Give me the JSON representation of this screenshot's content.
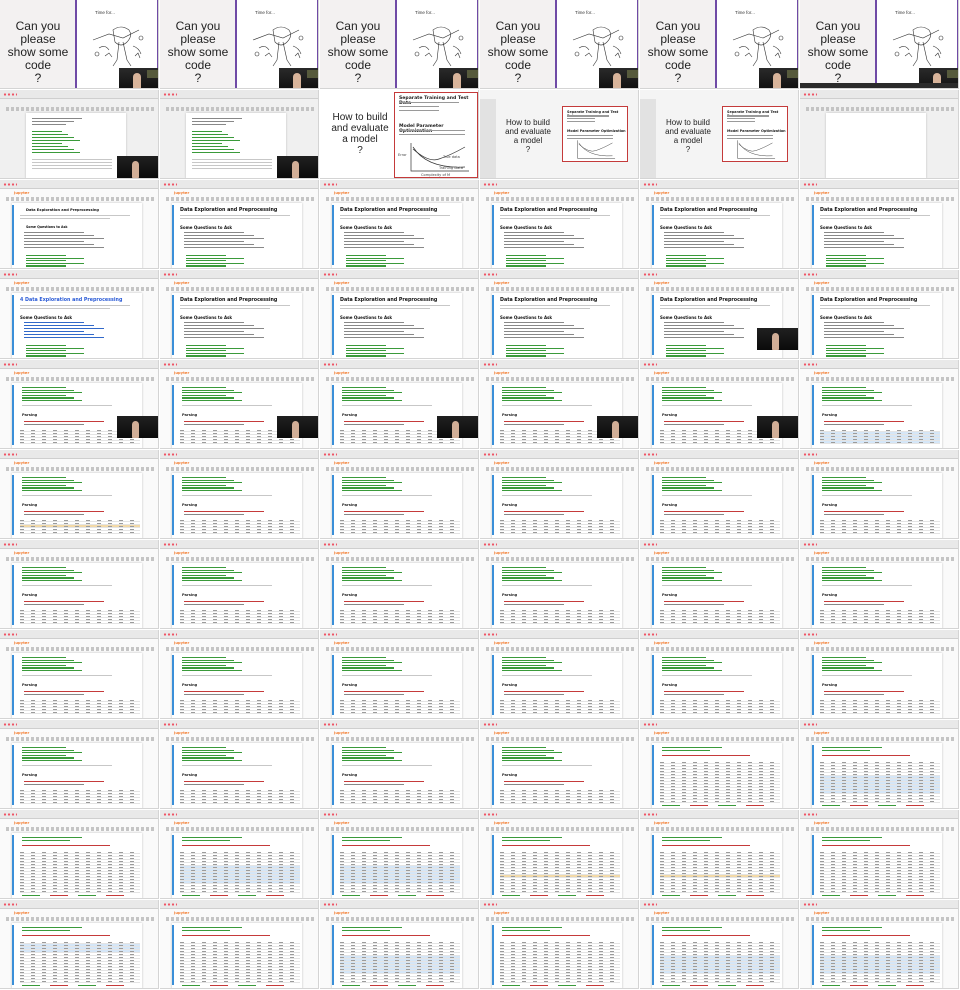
{
  "slides": {
    "code_question": "Can you please\nshow some\ncode\n?",
    "time_for": "Time for...",
    "eval_question": "How to build\nand evaluate\na model\n?",
    "eval_heading_1": "Separate Training and Test Data",
    "eval_heading_2": "Model Parameter Optimization",
    "eval_axis_error": "Error",
    "eval_axis_complexity": "Complexity of M",
    "eval_label_true": "True data",
    "eval_label_training": "Training Data"
  },
  "notebook": {
    "logo": "jupyter",
    "section_title": "Data Exploration and Preprocessing",
    "section_title_numbered": "4 Data Exploration and Preprocessing",
    "sub_heading": "Some Questions to Ask",
    "parsing_heading": "Parsing"
  },
  "colors": {
    "slide_bg": "#f3f1f1",
    "purple_border": "#6f4aa6",
    "red_border": "#c43a3a",
    "jupyter_orange": "#f37726",
    "cell_accent": "#3b8fd8",
    "row_highlight": "#d5e6f7"
  },
  "grid": {
    "columns": 6,
    "rows": 11,
    "cells": [
      "code",
      "code",
      "code",
      "code",
      "code",
      "code-bar",
      "nb-old",
      "nb-old",
      "eval",
      "eval-screen",
      "eval-screen",
      "nb-old-blank",
      "nb-md-small",
      "nb-md",
      "nb-md",
      "nb-md",
      "nb-md",
      "nb-md",
      "nb-md-blue",
      "nb-md",
      "nb-md",
      "nb-md",
      "nb-md-cam",
      "nb-md",
      "nb-parse-cam",
      "nb-parse-cam",
      "nb-parse-cam",
      "nb-parse-cam",
      "nb-parse-cam",
      "nb-parse-hl",
      "nb-parse-o",
      "nb-parse",
      "nb-parse",
      "nb-parse",
      "nb-parse",
      "nb-parse",
      "nb-parse",
      "nb-parse",
      "nb-parse",
      "nb-parse",
      "nb-parse",
      "nb-parse",
      "nb-parse",
      "nb-parse",
      "nb-parse",
      "nb-parse",
      "nb-parse",
      "nb-parse",
      "nb-parse",
      "nb-parse",
      "nb-parse",
      "nb-parse",
      "nb-table",
      "nb-table-hl",
      "nb-table",
      "nb-table-hl",
      "nb-table-hl",
      "nb-table-o",
      "nb-table-o",
      "nb-table",
      "nb-table-b",
      "nb-table",
      "nb-table-hl",
      "nb-table",
      "nb-table-hl",
      "nb-table-hl"
    ]
  }
}
